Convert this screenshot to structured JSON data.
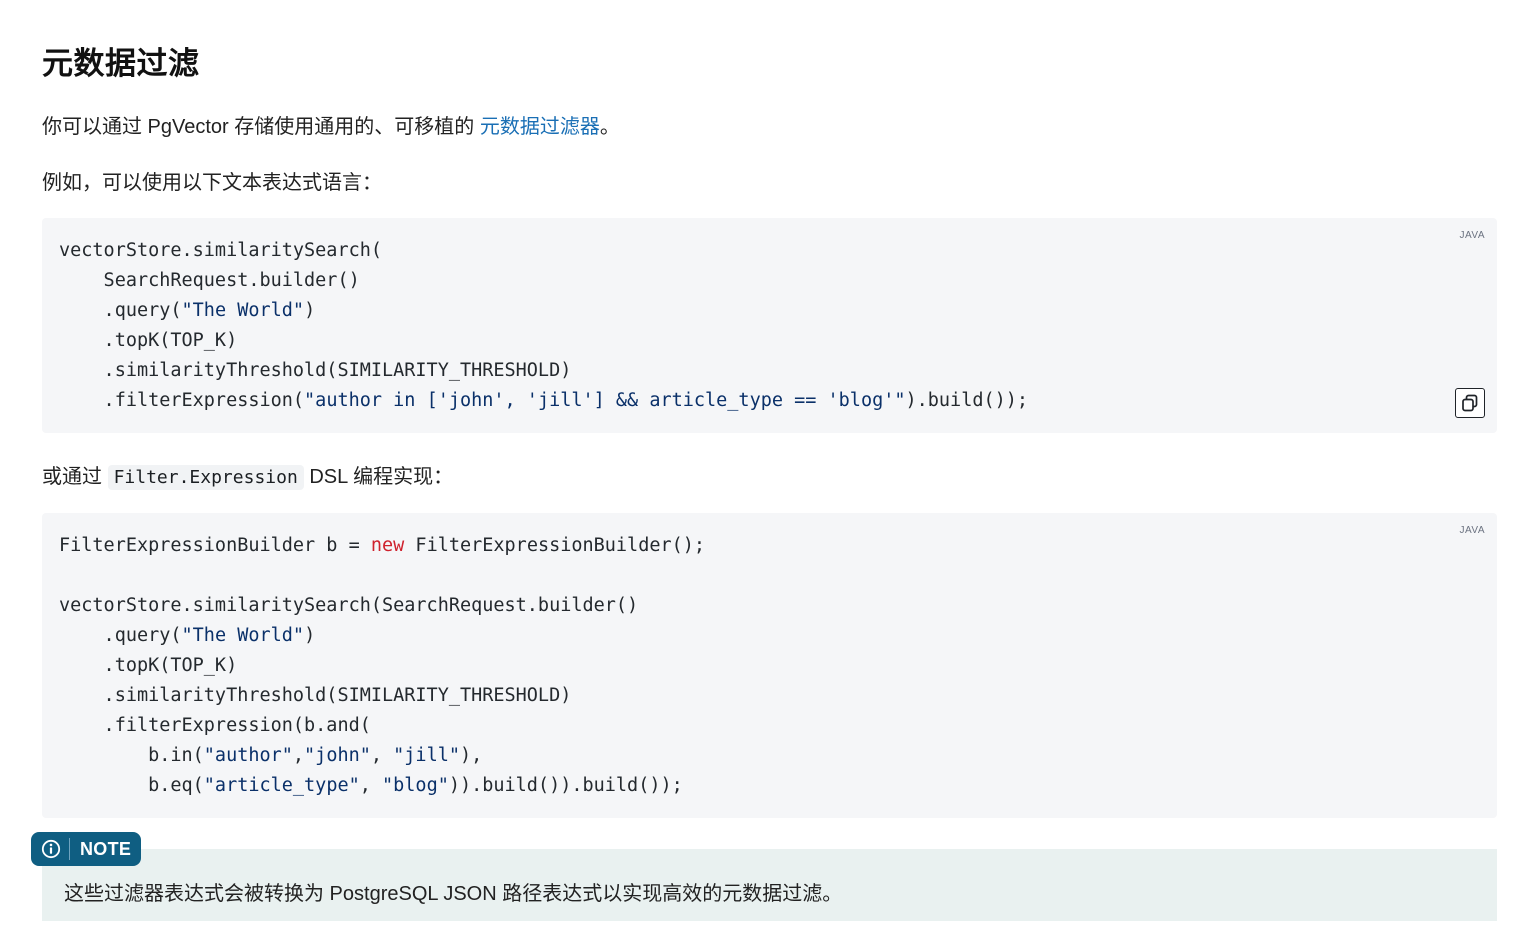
{
  "heading": "元数据过滤",
  "intro": {
    "before": "你可以通过 PgVector 存储使用通用的、可移植的 ",
    "link": "元数据过滤器",
    "after": "。"
  },
  "example_text": "例如，可以使用以下文本表达式语言：",
  "code1": {
    "lang": "JAVA",
    "line1": "vectorStore.similaritySearch(",
    "line2": "    SearchRequest.builder()",
    "line3_pre": "    .query(",
    "line3_str": "\"The World\"",
    "line3_post": ")",
    "line4": "    .topK(TOP_K)",
    "line5": "    .similarityThreshold(SIMILARITY_THRESHOLD)",
    "line6_pre": "    .filterExpression(",
    "line6_str": "\"author in ['john', 'jill'] && article_type == 'blog'\"",
    "line6_post": ").build());"
  },
  "or_text": {
    "before": "或通过 ",
    "code": "Filter.Expression",
    "after": " DSL 编程实现："
  },
  "code2": {
    "lang": "JAVA",
    "l1_pre": "FilterExpressionBuilder b = ",
    "l1_kw": "new",
    "l1_post": " FilterExpressionBuilder();",
    "l3": "vectorStore.similaritySearch(SearchRequest.builder()",
    "l4_pre": "    .query(",
    "l4_str": "\"The World\"",
    "l4_post": ")",
    "l5": "    .topK(TOP_K)",
    "l6": "    .similarityThreshold(SIMILARITY_THRESHOLD)",
    "l7": "    .filterExpression(b.and(",
    "l8_pre": "        b.in(",
    "l8_s1": "\"author\"",
    "l8_c1": ",",
    "l8_s2": "\"john\"",
    "l8_c2": ", ",
    "l8_s3": "\"jill\"",
    "l8_post": "),",
    "l9_pre": "        b.eq(",
    "l9_s1": "\"article_type\"",
    "l9_c1": ", ",
    "l9_s2": "\"blog\"",
    "l9_post": ")).build()).build());"
  },
  "note": {
    "label": "NOTE",
    "text": "这些过滤器表达式会被转换为 PostgreSQL JSON 路径表达式以实现高效的元数据过滤。"
  },
  "icons": [
    "copy-icon",
    "info-icon"
  ]
}
